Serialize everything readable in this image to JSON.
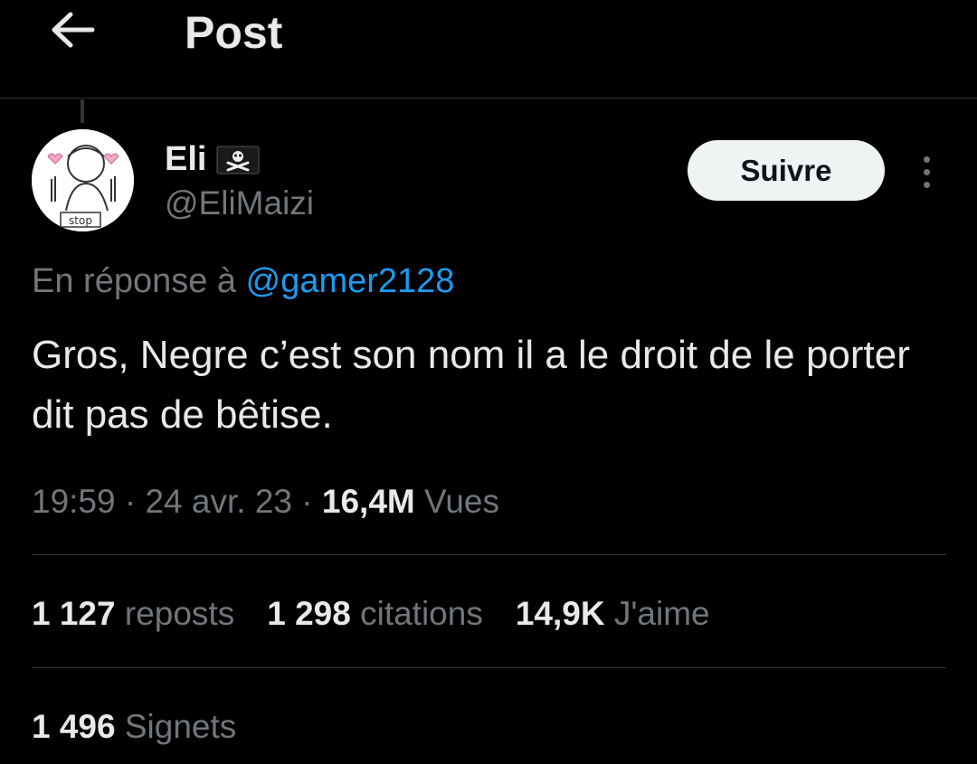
{
  "header": {
    "title": "Post",
    "back_icon": "arrow-left-icon"
  },
  "author": {
    "display_name": "Eli",
    "name_emoji": "pirate-flag-icon",
    "username": "@EliMaizi",
    "avatar_text": "stop"
  },
  "actions": {
    "follow_label": "Suivre",
    "more_icon": "more-vertical-icon"
  },
  "reply": {
    "prefix": "En réponse à",
    "mention": "@gamer2128"
  },
  "tweet": {
    "text": "Gros, Negre c’est son nom il a le droit de le porter dit pas de bêtise."
  },
  "meta": {
    "time": "19:59",
    "date": "24 avr. 23",
    "views_count": "16,4M",
    "views_label": "Vues"
  },
  "stats": {
    "reposts_count": "1 127",
    "reposts_label": "reposts",
    "quotes_count": "1 298",
    "quotes_label": "citations",
    "likes_count": "14,9K",
    "likes_label": "J'aime"
  },
  "bookmarks": {
    "count": "1 496",
    "label": "Signets"
  },
  "colors": {
    "background": "#000000",
    "text_primary": "#e7e9ea",
    "text_secondary": "#71767b",
    "link": "#1d9bf0",
    "divider": "#2f3336",
    "button_bg": "#eff3f4"
  }
}
